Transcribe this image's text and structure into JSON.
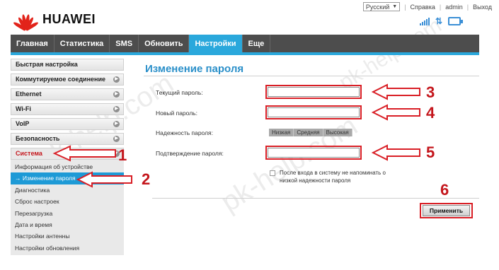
{
  "header": {
    "brand": "HUAWEI",
    "language": "Русский",
    "help": "Справка",
    "user": "admin",
    "logout": "Выход"
  },
  "nav": {
    "items": [
      "Главная",
      "Статистика",
      "SMS",
      "Обновить",
      "Настройки",
      "Еще"
    ],
    "active_index": 4
  },
  "sidebar": {
    "items": [
      "Быстрая настройка",
      "Коммутируемое соединение",
      "Ethernet",
      "Wi-Fi",
      "VoIP",
      "Безопасность",
      "Система"
    ],
    "submenu": [
      "Информация об устройстве",
      "Изменение пароля",
      "Диагностика",
      "Сброс настроек",
      "Перезагрузка",
      "Дата и время",
      "Настройки антенны",
      "Настройки обновления"
    ],
    "active_sub": "Изменение пароля"
  },
  "main": {
    "title": "Изменение пароля",
    "current_password_label": "Текущий пароль:",
    "new_password_label": "Новый пароль:",
    "strength_label": "Надежность пароля:",
    "strength_levels": [
      "Низкая",
      "Средняя",
      "Высокая"
    ],
    "confirm_label": "Подтверждение пароля:",
    "checkbox_text": "После входа в систему не напоминать о низкой надежности пароля",
    "apply_button": "Применить"
  },
  "annotations": [
    "1",
    "2",
    "3",
    "4",
    "5",
    "6"
  ],
  "colors": {
    "accent": "#2aa8dc",
    "nav_bg": "#4d4d4d",
    "annotation_red": "#d91f26"
  },
  "watermark": "pk-help.com"
}
